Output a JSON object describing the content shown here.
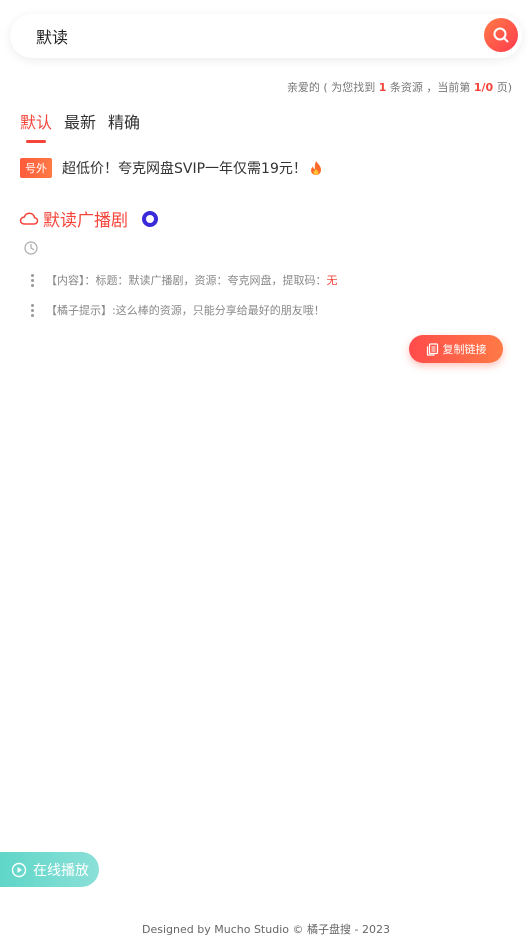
{
  "search": {
    "value": "默读"
  },
  "summary": {
    "prefix": "亲爱的 ( 为您找到 ",
    "count": "1",
    "middle": " 条资源 ，当前第 ",
    "page": "1/0",
    "suffix": " 页)"
  },
  "tabs": [
    {
      "label": "默认",
      "active": true
    },
    {
      "label": "最新",
      "active": false
    },
    {
      "label": "精确",
      "active": false
    }
  ],
  "promo": {
    "badge": "号外",
    "text": "超低价！夸克网盘SVIP一年仅需19元！"
  },
  "resource": {
    "title": "默读广播剧",
    "content_label": "【内容】：标题：默读广播剧，资源：夸克网盘，提取码：",
    "code_value": "无",
    "tip": "【橘子提示】:这么棒的资源，只能分享给最好的朋友哦！",
    "copy_label": "复制链接"
  },
  "online_play": {
    "label": "在线播放"
  },
  "footer": {
    "text": "Designed by Mucho Studio © 橘子盘搜 - 2023"
  },
  "colors": {
    "accent": "#f5453b",
    "status_ring": "#3a2bd8",
    "online_play": "#5fd6c8"
  }
}
